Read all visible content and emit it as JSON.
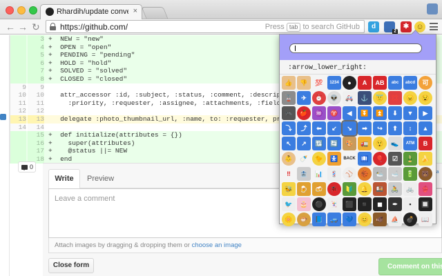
{
  "browser": {
    "tab_title": "Rhardih/update conversatio",
    "tab_close": "×",
    "url": "https://github.com/",
    "omnibox_hint_prefix": "Press",
    "omnibox_hint_key": "tab",
    "omnibox_hint_suffix": "to search GitHub",
    "back_glyph": "←",
    "forward_glyph": "→",
    "reload_glyph": "↻",
    "extensions": [
      {
        "name": "d-extension-icon",
        "label": "d",
        "color": "#35a3e0"
      },
      {
        "name": "badge-extension-icon",
        "label": "2",
        "color": "#3d6fb7"
      },
      {
        "name": "star-extension-icon",
        "label": "✱",
        "color": "#d4262c"
      },
      {
        "name": "smiley-extension-icon",
        "label": "☺",
        "color": "#f4d342"
      }
    ]
  },
  "diff": {
    "lines": [
      {
        "type": "add",
        "n1": "",
        "n2": "3",
        "code": "+  NEW = \"new\""
      },
      {
        "type": "add",
        "n1": "",
        "n2": "4",
        "code": "+  OPEN = \"open\""
      },
      {
        "type": "add",
        "n1": "",
        "n2": "5",
        "code": "+  PENDING = \"pending\""
      },
      {
        "type": "add",
        "n1": "",
        "n2": "6",
        "code": "+  HOLD = \"hold\""
      },
      {
        "type": "add",
        "n1": "",
        "n2": "7",
        "code": "+  SOLVED = \"solved\""
      },
      {
        "type": "add",
        "n1": "",
        "n2": "8",
        "code": "+  CLOSED = \"closed\""
      },
      {
        "type": "ctx",
        "n1": "9",
        "n2": "9",
        "code": ""
      },
      {
        "type": "ctx",
        "n1": "10",
        "n2": "10",
        "code": "   attr_accessor :id, :subject, :status, :comment, :description, :u"
      },
      {
        "type": "ctx",
        "n1": "11",
        "n2": "11",
        "code": "     :priority, :requester, :assignee, :attachments, :fields, :type"
      },
      {
        "type": "ctx",
        "n1": "12",
        "n2": "12",
        "code": ""
      },
      {
        "type": "hl",
        "n1": "13",
        "n2": "13",
        "code": "   delegate :photo_thumbnail_url, :name, to: :requester, prefix: tr"
      },
      {
        "type": "ctx",
        "n1": "14",
        "n2": "14",
        "code": ""
      },
      {
        "type": "add",
        "n1": "",
        "n2": "15",
        "code": "+  def initialize(attributes = {})"
      },
      {
        "type": "add",
        "n1": "",
        "n2": "16",
        "code": "+    super(attributes)"
      },
      {
        "type": "add",
        "n1": "",
        "n2": "17",
        "code": "+    @status ||= NEW"
      },
      {
        "type": "add",
        "n1": "",
        "n2": "18",
        "code": "+  end"
      }
    ]
  },
  "comment": {
    "count": "0",
    "tab_write": "Write",
    "tab_preview": "Preview",
    "placeholder": "Leave a comment",
    "attach_text": "Attach images by dragging & dropping them or",
    "attach_link": "choose an image",
    "close_button": "Close form",
    "submit_button": "Comment on this l",
    "side_link": "d Ma"
  },
  "emoji_popup": {
    "search_value": "",
    "selected_name": ":arrow_lower_right:",
    "emojis": [
      {
        "name": "thumbsup",
        "glyph": "👍",
        "bg": "#e9c08a"
      },
      {
        "name": "thumbsdown",
        "glyph": "👎",
        "bg": "#e9c08a"
      },
      {
        "name": "100",
        "glyph": "💯",
        "bg": "#f4f4f4",
        "fg": "#d22"
      },
      {
        "name": "1234",
        "glyph": "1234",
        "bg": "#3b7de0"
      },
      {
        "name": "8ball",
        "glyph": "●",
        "bg": "#222",
        "round": true
      },
      {
        "name": "a",
        "glyph": "A",
        "bg": "#d8262a"
      },
      {
        "name": "ab",
        "glyph": "AB",
        "bg": "#d8262a"
      },
      {
        "name": "abc",
        "glyph": "abc",
        "bg": "#3b7de0"
      },
      {
        "name": "abcd",
        "glyph": "abcd",
        "bg": "#3b7de0"
      },
      {
        "name": "accept",
        "glyph": "可",
        "bg": "#f3a23a",
        "round": true
      },
      {
        "name": "aerial_tramway",
        "glyph": "🚡",
        "bg": "#8c8c8c"
      },
      {
        "name": "airplane",
        "glyph": "✈",
        "bg": "#3b7de0"
      },
      {
        "name": "alarm_clock",
        "glyph": "⏰",
        "bg": "#e04040",
        "round": true
      },
      {
        "name": "alien",
        "glyph": "👽",
        "bg": "#ddd",
        "round": true
      },
      {
        "name": "ambulance",
        "glyph": "🚑",
        "bg": "#f0f0f0"
      },
      {
        "name": "anchor",
        "glyph": "⚓",
        "bg": "#3b4f7a"
      },
      {
        "name": "angel",
        "glyph": "😇",
        "bg": "#f4d342",
        "round": true
      },
      {
        "name": "anger",
        "glyph": "💢",
        "bg": "#e04040"
      },
      {
        "name": "angry",
        "glyph": "😠",
        "bg": "#f4d342",
        "round": true
      },
      {
        "name": "anguished",
        "glyph": "😧",
        "bg": "#f4d342",
        "round": true
      },
      {
        "name": "ant",
        "glyph": "🐜",
        "bg": "#555"
      },
      {
        "name": "apple",
        "glyph": "🍎",
        "bg": "#d8262a",
        "round": true
      },
      {
        "name": "aquarius",
        "glyph": "♒",
        "bg": "#9a4fc8"
      },
      {
        "name": "aries",
        "glyph": "♈",
        "bg": "#9a4fc8"
      },
      {
        "name": "arrow_backward",
        "glyph": "◀",
        "bg": "#3b7de0"
      },
      {
        "name": "arrow_double_down",
        "glyph": "⏬",
        "bg": "#3b7de0"
      },
      {
        "name": "arrow_double_up",
        "glyph": "⏫",
        "bg": "#3b7de0"
      },
      {
        "name": "arrow_down",
        "glyph": "⬇",
        "bg": "#3b7de0"
      },
      {
        "name": "arrow_down_small",
        "glyph": "▼",
        "bg": "#3b7de0"
      },
      {
        "name": "arrow_forward",
        "glyph": "▶",
        "bg": "#3b7de0"
      },
      {
        "name": "arrow_heading_down",
        "glyph": "⤵",
        "bg": "#3b7de0"
      },
      {
        "name": "arrow_heading_up",
        "glyph": "⤴",
        "bg": "#3b7de0"
      },
      {
        "name": "arrow_left",
        "glyph": "⬅",
        "bg": "#3b7de0"
      },
      {
        "name": "arrow_lower_left",
        "glyph": "↙",
        "bg": "#3b7de0"
      },
      {
        "name": "arrow_lower_right",
        "glyph": "↘",
        "bg": "#3b7de0",
        "selected": true
      },
      {
        "name": "arrow_right",
        "glyph": "➡",
        "bg": "#3b7de0"
      },
      {
        "name": "arrow_right_hook",
        "glyph": "↪",
        "bg": "#3b7de0"
      },
      {
        "name": "arrow_up",
        "glyph": "⬆",
        "bg": "#3b7de0"
      },
      {
        "name": "arrow_up_down",
        "glyph": "↕",
        "bg": "#3b7de0"
      },
      {
        "name": "arrow_up_small",
        "glyph": "▲",
        "bg": "#3b7de0"
      },
      {
        "name": "arrow_upper_left",
        "glyph": "↖",
        "bg": "#3b7de0"
      },
      {
        "name": "arrow_upper_right",
        "glyph": "↗",
        "bg": "#3b7de0"
      },
      {
        "name": "arrows_clockwise",
        "glyph": "🔃",
        "bg": "#3b7de0"
      },
      {
        "name": "arrows_counterclockwise",
        "glyph": "🔄",
        "bg": "#3b7de0"
      },
      {
        "name": "art",
        "glyph": "🎨",
        "bg": "#c89a5c"
      },
      {
        "name": "articulated_lorry",
        "glyph": "🚛",
        "bg": "#f0b030"
      },
      {
        "name": "astonished",
        "glyph": "😲",
        "bg": "#f4d342",
        "round": true
      },
      {
        "name": "athletic_shoe",
        "glyph": "👟",
        "bg": "#ddd"
      },
      {
        "name": "atm",
        "glyph": "ATM",
        "bg": "#3b7de0"
      },
      {
        "name": "b",
        "glyph": "B",
        "bg": "#d8262a"
      },
      {
        "name": "baby",
        "glyph": "👶",
        "bg": "#e9c08a",
        "round": true
      },
      {
        "name": "baby_bottle",
        "glyph": "🍼",
        "bg": "#f4f4f4"
      },
      {
        "name": "baby_chick",
        "glyph": "🐤",
        "bg": "#f4d342",
        "round": true
      },
      {
        "name": "baby_symbol",
        "glyph": "🚼",
        "bg": "#f0a030"
      },
      {
        "name": "back",
        "glyph": "BACK",
        "bg": "#f4f4f4",
        "fg": "#222"
      },
      {
        "name": "baggage_claim",
        "glyph": "🛄",
        "bg": "#3b7de0"
      },
      {
        "name": "balloon",
        "glyph": "🎈",
        "bg": "#d8262a",
        "round": true
      },
      {
        "name": "ballot_box_with_check",
        "glyph": "☑",
        "bg": "#555"
      },
      {
        "name": "bamboo",
        "glyph": "🎍",
        "bg": "#5a9a3a"
      },
      {
        "name": "banana",
        "glyph": "🍌",
        "bg": "#f4d342"
      },
      {
        "name": "bangbang",
        "glyph": "‼",
        "bg": "#f4f4f4",
        "fg": "#d22"
      },
      {
        "name": "bank",
        "glyph": "🏦",
        "bg": "#ccc"
      },
      {
        "name": "bar_chart",
        "glyph": "📊",
        "bg": "#f4f4f4",
        "fg": "#3b7de0"
      },
      {
        "name": "barber",
        "glyph": "💈",
        "bg": "#eee",
        "fg": "#d22"
      },
      {
        "name": "baseball",
        "glyph": "⚾",
        "bg": "#eee",
        "round": true,
        "fg": "#d22"
      },
      {
        "name": "basketball",
        "glyph": "🏀",
        "bg": "#e07a2a",
        "round": true
      },
      {
        "name": "bath",
        "glyph": "🛀",
        "bg": "#bbb"
      },
      {
        "name": "bathtub",
        "glyph": "🛁",
        "bg": "#ccc"
      },
      {
        "name": "battery",
        "glyph": "🔋",
        "bg": "#5a9a3a"
      },
      {
        "name": "bear",
        "glyph": "🐻",
        "bg": "#8a5a2a",
        "round": true
      },
      {
        "name": "bee",
        "glyph": "🐝",
        "bg": "#f4d342"
      },
      {
        "name": "beer",
        "glyph": "🍺",
        "bg": "#e0a030"
      },
      {
        "name": "beers",
        "glyph": "🍻",
        "bg": "#e0a030"
      },
      {
        "name": "beetle",
        "glyph": "🐞",
        "bg": "#d8262a",
        "round": true
      },
      {
        "name": "beginner",
        "glyph": "🔰",
        "bg": "#5a9a3a"
      },
      {
        "name": "bell",
        "glyph": "🔔",
        "bg": "#f4d342",
        "round": true
      },
      {
        "name": "bento",
        "glyph": "🍱",
        "bg": "#bb5533"
      },
      {
        "name": "bicyclist",
        "glyph": "🚴",
        "bg": "#ccc"
      },
      {
        "name": "bike",
        "glyph": "🚲",
        "bg": "#eee",
        "fg": "#555"
      },
      {
        "name": "bikini",
        "glyph": "👙",
        "bg": "#e05080"
      },
      {
        "name": "bird",
        "glyph": "🐦",
        "bg": "#eee",
        "fg": "#555"
      },
      {
        "name": "birthday",
        "glyph": "🎂",
        "bg": "#f4c0d0"
      },
      {
        "name": "black_circle",
        "glyph": "⚫",
        "bg": "#222",
        "round": true
      },
      {
        "name": "black_joker",
        "glyph": "🃏",
        "bg": "#eee",
        "fg": "#222"
      },
      {
        "name": "black_large_square",
        "glyph": "⬛",
        "bg": "#222"
      },
      {
        "name": "black_medium_small_square",
        "glyph": "◾",
        "bg": "#222"
      },
      {
        "name": "black_medium_square",
        "glyph": "◼",
        "bg": "#222"
      },
      {
        "name": "black_nib",
        "glyph": "✒",
        "bg": "#333"
      },
      {
        "name": "black_small_square",
        "glyph": "▪",
        "bg": "#eee",
        "fg": "#222"
      },
      {
        "name": "black_square_button",
        "glyph": "🔲",
        "bg": "#222"
      },
      {
        "name": "blossom",
        "glyph": "🌼",
        "bg": "#f4d342",
        "round": true
      },
      {
        "name": "blowfish",
        "glyph": "🐡",
        "bg": "#d8a040",
        "round": true
      },
      {
        "name": "blue_book",
        "glyph": "📘",
        "bg": "#3b7de0"
      },
      {
        "name": "blue_car",
        "glyph": "🚙",
        "bg": "#3b7de0"
      },
      {
        "name": "blue_heart",
        "glyph": "💙",
        "bg": "#3b7de0"
      },
      {
        "name": "blush",
        "glyph": "😊",
        "bg": "#f4d342",
        "round": true
      },
      {
        "name": "boar",
        "glyph": "🐗",
        "bg": "#8a5a2a"
      },
      {
        "name": "boat",
        "glyph": "⛵",
        "bg": "#eee",
        "fg": "#d22"
      },
      {
        "name": "bomb",
        "glyph": "💣",
        "bg": "#222",
        "round": true
      },
      {
        "name": "book",
        "glyph": "📖",
        "bg": "#eee",
        "fg": "#222"
      }
    ]
  }
}
